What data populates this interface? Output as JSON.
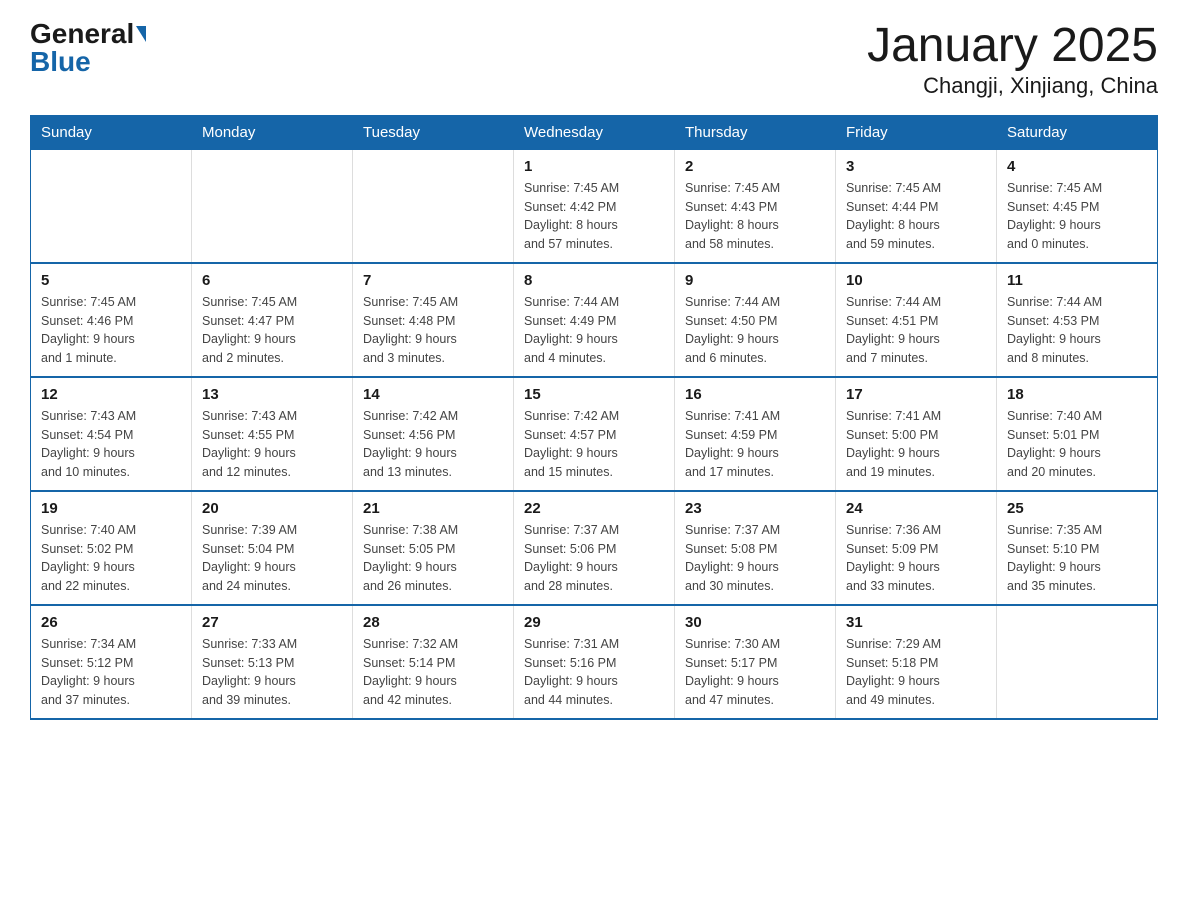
{
  "logo": {
    "general": "General",
    "blue": "Blue"
  },
  "title": "January 2025",
  "subtitle": "Changji, Xinjiang, China",
  "weekdays": [
    "Sunday",
    "Monday",
    "Tuesday",
    "Wednesday",
    "Thursday",
    "Friday",
    "Saturday"
  ],
  "weeks": [
    [
      {
        "day": "",
        "info": ""
      },
      {
        "day": "",
        "info": ""
      },
      {
        "day": "",
        "info": ""
      },
      {
        "day": "1",
        "info": "Sunrise: 7:45 AM\nSunset: 4:42 PM\nDaylight: 8 hours\nand 57 minutes."
      },
      {
        "day": "2",
        "info": "Sunrise: 7:45 AM\nSunset: 4:43 PM\nDaylight: 8 hours\nand 58 minutes."
      },
      {
        "day": "3",
        "info": "Sunrise: 7:45 AM\nSunset: 4:44 PM\nDaylight: 8 hours\nand 59 minutes."
      },
      {
        "day": "4",
        "info": "Sunrise: 7:45 AM\nSunset: 4:45 PM\nDaylight: 9 hours\nand 0 minutes."
      }
    ],
    [
      {
        "day": "5",
        "info": "Sunrise: 7:45 AM\nSunset: 4:46 PM\nDaylight: 9 hours\nand 1 minute."
      },
      {
        "day": "6",
        "info": "Sunrise: 7:45 AM\nSunset: 4:47 PM\nDaylight: 9 hours\nand 2 minutes."
      },
      {
        "day": "7",
        "info": "Sunrise: 7:45 AM\nSunset: 4:48 PM\nDaylight: 9 hours\nand 3 minutes."
      },
      {
        "day": "8",
        "info": "Sunrise: 7:44 AM\nSunset: 4:49 PM\nDaylight: 9 hours\nand 4 minutes."
      },
      {
        "day": "9",
        "info": "Sunrise: 7:44 AM\nSunset: 4:50 PM\nDaylight: 9 hours\nand 6 minutes."
      },
      {
        "day": "10",
        "info": "Sunrise: 7:44 AM\nSunset: 4:51 PM\nDaylight: 9 hours\nand 7 minutes."
      },
      {
        "day": "11",
        "info": "Sunrise: 7:44 AM\nSunset: 4:53 PM\nDaylight: 9 hours\nand 8 minutes."
      }
    ],
    [
      {
        "day": "12",
        "info": "Sunrise: 7:43 AM\nSunset: 4:54 PM\nDaylight: 9 hours\nand 10 minutes."
      },
      {
        "day": "13",
        "info": "Sunrise: 7:43 AM\nSunset: 4:55 PM\nDaylight: 9 hours\nand 12 minutes."
      },
      {
        "day": "14",
        "info": "Sunrise: 7:42 AM\nSunset: 4:56 PM\nDaylight: 9 hours\nand 13 minutes."
      },
      {
        "day": "15",
        "info": "Sunrise: 7:42 AM\nSunset: 4:57 PM\nDaylight: 9 hours\nand 15 minutes."
      },
      {
        "day": "16",
        "info": "Sunrise: 7:41 AM\nSunset: 4:59 PM\nDaylight: 9 hours\nand 17 minutes."
      },
      {
        "day": "17",
        "info": "Sunrise: 7:41 AM\nSunset: 5:00 PM\nDaylight: 9 hours\nand 19 minutes."
      },
      {
        "day": "18",
        "info": "Sunrise: 7:40 AM\nSunset: 5:01 PM\nDaylight: 9 hours\nand 20 minutes."
      }
    ],
    [
      {
        "day": "19",
        "info": "Sunrise: 7:40 AM\nSunset: 5:02 PM\nDaylight: 9 hours\nand 22 minutes."
      },
      {
        "day": "20",
        "info": "Sunrise: 7:39 AM\nSunset: 5:04 PM\nDaylight: 9 hours\nand 24 minutes."
      },
      {
        "day": "21",
        "info": "Sunrise: 7:38 AM\nSunset: 5:05 PM\nDaylight: 9 hours\nand 26 minutes."
      },
      {
        "day": "22",
        "info": "Sunrise: 7:37 AM\nSunset: 5:06 PM\nDaylight: 9 hours\nand 28 minutes."
      },
      {
        "day": "23",
        "info": "Sunrise: 7:37 AM\nSunset: 5:08 PM\nDaylight: 9 hours\nand 30 minutes."
      },
      {
        "day": "24",
        "info": "Sunrise: 7:36 AM\nSunset: 5:09 PM\nDaylight: 9 hours\nand 33 minutes."
      },
      {
        "day": "25",
        "info": "Sunrise: 7:35 AM\nSunset: 5:10 PM\nDaylight: 9 hours\nand 35 minutes."
      }
    ],
    [
      {
        "day": "26",
        "info": "Sunrise: 7:34 AM\nSunset: 5:12 PM\nDaylight: 9 hours\nand 37 minutes."
      },
      {
        "day": "27",
        "info": "Sunrise: 7:33 AM\nSunset: 5:13 PM\nDaylight: 9 hours\nand 39 minutes."
      },
      {
        "day": "28",
        "info": "Sunrise: 7:32 AM\nSunset: 5:14 PM\nDaylight: 9 hours\nand 42 minutes."
      },
      {
        "day": "29",
        "info": "Sunrise: 7:31 AM\nSunset: 5:16 PM\nDaylight: 9 hours\nand 44 minutes."
      },
      {
        "day": "30",
        "info": "Sunrise: 7:30 AM\nSunset: 5:17 PM\nDaylight: 9 hours\nand 47 minutes."
      },
      {
        "day": "31",
        "info": "Sunrise: 7:29 AM\nSunset: 5:18 PM\nDaylight: 9 hours\nand 49 minutes."
      },
      {
        "day": "",
        "info": ""
      }
    ]
  ],
  "accent_color": "#1565a8"
}
